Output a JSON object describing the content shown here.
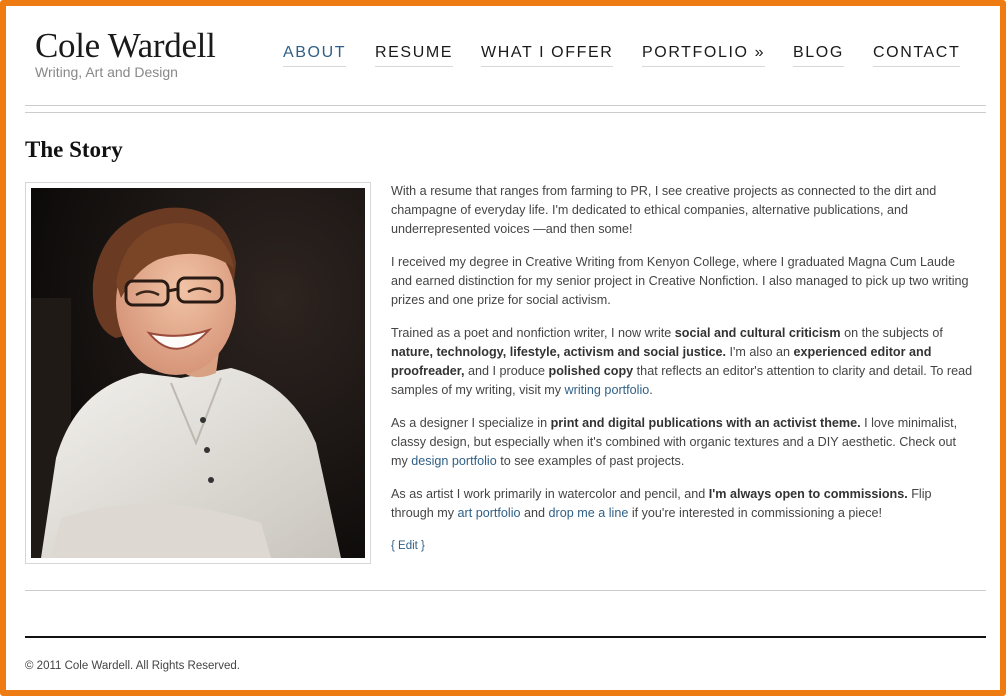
{
  "header": {
    "site_title": "Cole Wardell",
    "tagline": "Writing, Art and Design"
  },
  "nav": {
    "items": [
      {
        "label": "ABOUT",
        "active": true
      },
      {
        "label": "RESUME",
        "active": false
      },
      {
        "label": "WHAT I OFFER",
        "active": false
      },
      {
        "label": "PORTFOLIO »",
        "active": false
      },
      {
        "label": "BLOG",
        "active": false
      },
      {
        "label": "CONTACT",
        "active": false
      }
    ]
  },
  "page": {
    "title": "The Story",
    "photo_icon": "portrait-photo",
    "p1": "With a resume that ranges from farming to PR, I see creative projects as connected to the dirt and champagne of everyday life. I'm dedicated to ethical companies, alternative publications, and underrepresented voices —and then some!",
    "p2": "I received my degree in Creative Writing from Kenyon College, where I graduated Magna Cum Laude and earned distinction for my senior project in Creative Nonfiction. I also managed to pick up two writing prizes and one prize for social activism.",
    "p3": {
      "t1": "Trained as a poet and nonfiction writer, I now write ",
      "b1": "social and cultural criticism",
      "t2": " on the subjects of ",
      "b2": "nature, technology, lifestyle, activism and social justice.",
      "t3": " I'm also an ",
      "b3": "experienced editor and proofreader,",
      "t4": " and I produce ",
      "b4": "polished copy",
      "t5": " that reflects an editor's attention to clarity and detail. To read samples of my writing, visit my ",
      "link1": "writing portfolio",
      "t6": "."
    },
    "p4": {
      "t1": "As a designer I specialize in ",
      "b1": "print and digital publications with an activist theme.",
      "t2": " I love minimalist, classy design, but especially when it's combined with organic textures and a DIY aesthetic. Check out my ",
      "link1": "design portfolio",
      "t3": " to see examples of past projects."
    },
    "p5": {
      "t1": "As as artist I work primarily in watercolor and pencil, and ",
      "b1": "I'm always open to commissions.",
      "t2": " Flip through my ",
      "link1": "art portfolio",
      "t3": " and ",
      "link2": "drop me a line",
      "t4": " if you're interested in commissioning a piece!"
    },
    "edit_label": "{ Edit }"
  },
  "footer": {
    "copyright": "© 2011 Cole Wardell. All Rights Reserved."
  },
  "colors": {
    "frame_border": "#ee7c12",
    "link": "#2f5f86",
    "active_nav": "#2f5f86",
    "text": "#444444"
  }
}
